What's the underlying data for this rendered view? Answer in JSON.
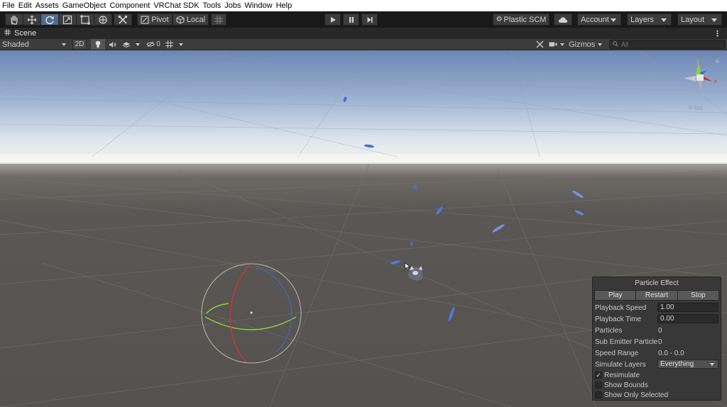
{
  "menu": [
    "File",
    "Edit",
    "Assets",
    "GameObject",
    "Component",
    "VRChat SDK",
    "Tools",
    "Jobs",
    "Window",
    "Help"
  ],
  "toolbar": {
    "pivot_label": "Pivot",
    "local_label": "Local",
    "plastic_label": "Plastic SCM",
    "account_label": "Account",
    "layers_label": "Layers",
    "layout_label": "Layout"
  },
  "tab": {
    "scene_label": "Scene",
    "menu_glyph": "⋮"
  },
  "scene_toolbar": {
    "shading_mode": "Shaded",
    "mode_2d": "2D",
    "hidden_count": "0",
    "gizmos_label": "Gizmos",
    "search_placeholder": "All"
  },
  "viewport": {
    "iso_label": "Iso",
    "gizmo_axes": {
      "x": "x",
      "y": "y"
    },
    "colors": {
      "sky_top": "#6c86b4",
      "horizon": "#f2f2ef",
      "ground": "#555250",
      "grid": "#6a6866",
      "axis_x": "#d0362f",
      "axis_y": "#8cd23c",
      "axis_z": "#3a6fd8"
    }
  },
  "particle_panel": {
    "title": "Particle Effect",
    "buttons": {
      "play": "Play",
      "restart": "Restart",
      "stop": "Stop"
    },
    "playback_speed_label": "Playback Speed",
    "playback_speed_value": "1.00",
    "playback_time_label": "Playback Time",
    "playback_time_value": "0.00",
    "particles_label": "Particles",
    "particles_value": "0",
    "sub_emitter_label": "Sub Emitter Particle",
    "sub_emitter_value": "0",
    "speed_range_label": "Speed Range",
    "speed_range_value": "0.0 - 0.0",
    "simulate_layers_label": "Simulate Layers",
    "simulate_layers_value": "Everything",
    "resimulate_label": "Resimulate",
    "resimulate_checked": true,
    "show_bounds_label": "Show Bounds",
    "show_bounds_checked": false,
    "show_only_selected_label": "Show Only Selected",
    "show_only_selected_checked": false,
    "check_glyph": "✓"
  }
}
